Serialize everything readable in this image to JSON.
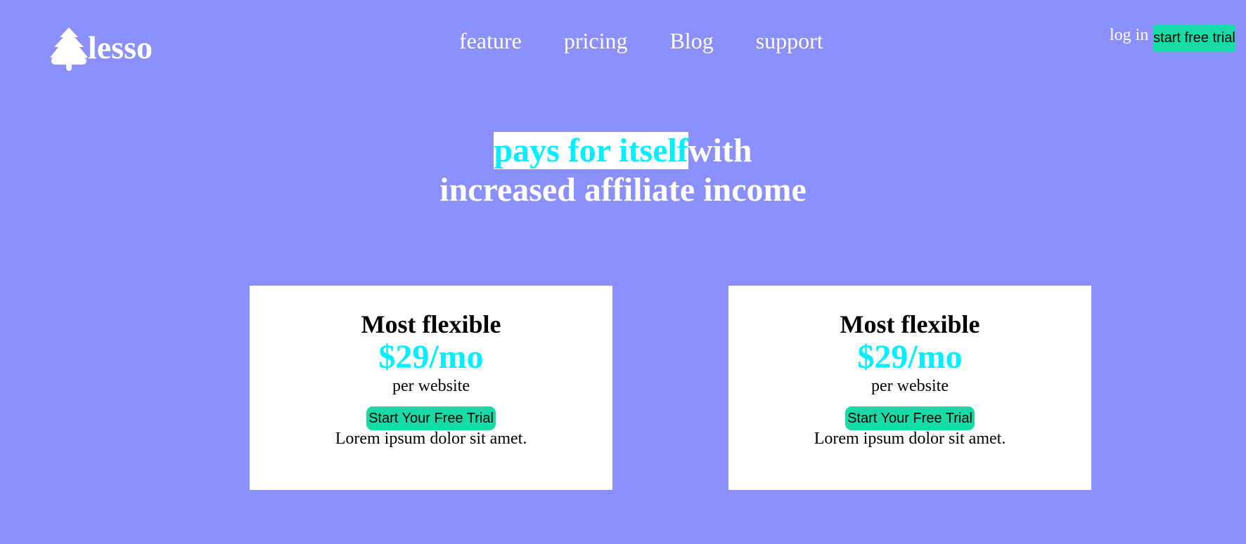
{
  "brand": {
    "logo_icon": "tree-icon",
    "name": "lesso"
  },
  "nav": {
    "items": [
      {
        "label": "feature"
      },
      {
        "label": "pricing"
      },
      {
        "label": "Blog"
      },
      {
        "label": "support"
      }
    ]
  },
  "header": {
    "login_label": "log in",
    "trial_label": "start free trial"
  },
  "hero": {
    "highlight": "pays for itself",
    "rest_line1": "with",
    "line2": "increased affiliate income"
  },
  "plans": [
    {
      "title": "Most flexible",
      "price": "$29/mo",
      "per": "per website",
      "button_label": "Start Your Free Trial",
      "description": "Lorem ipsum dolor sit amet."
    },
    {
      "title": "Most flexible",
      "price": "$29/mo",
      "per": "per website",
      "button_label": "Start Your Free Trial",
      "description": "Lorem ipsum dolor sit amet."
    }
  ],
  "colors": {
    "background": "#8b8ffb",
    "accent_cyan": "#00f0ff",
    "button_green": "#17dba6"
  }
}
